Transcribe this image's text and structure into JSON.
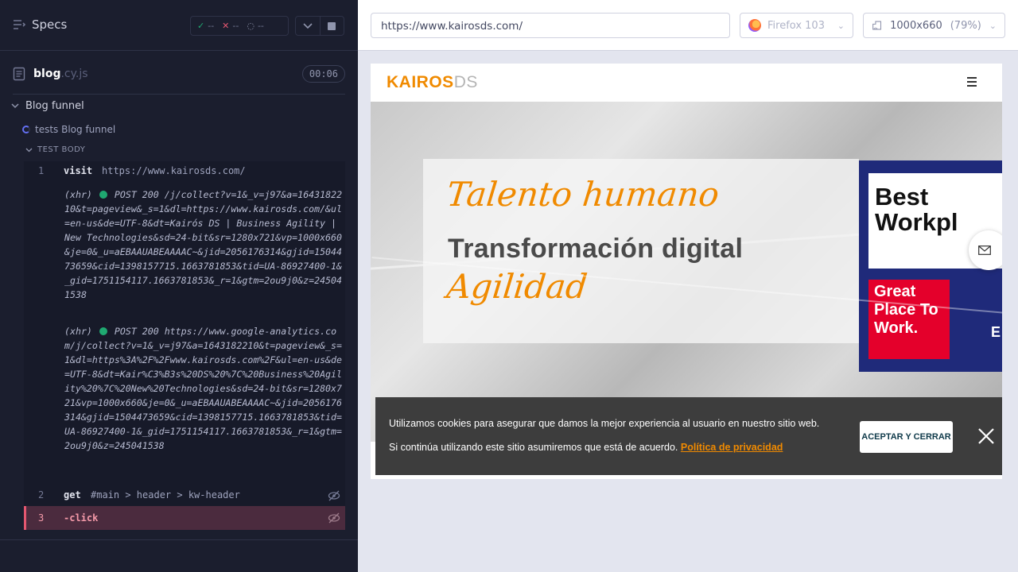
{
  "runner": {
    "specs_label": "Specs",
    "stats": {
      "passed": "--",
      "failed": "--",
      "pending": "--"
    },
    "file": {
      "name": "blog",
      "ext": ".cy.js",
      "duration": "00:06"
    },
    "suite": "Blog funnel",
    "test": "tests Blog funnel",
    "test_body": "TEST BODY",
    "commands": [
      {
        "num": "1",
        "name": "visit",
        "message": "https://www.kairosds.com/"
      },
      {
        "num": "2",
        "name": "get",
        "message": "#main > header > kw-header"
      },
      {
        "num": "3",
        "name": "-click",
        "message": ""
      }
    ],
    "xhr": [
      {
        "prefix": "(xhr)",
        "text": "POST 200 /j/collect?v=1&_v=j97&a=1643182210&t=pageview&_s=1&dl=https://www.kairosds.com/&ul=en-us&de=UTF-8&dt=Kairós DS | Business Agility | New Technologies&sd=24-bit&sr=1280x721&vp=1000x660&je=0&_u=aEBAAUABEAAAAC~&jid=2056176314&gjid=1504473659&cid=1398157715.1663781853&tid=UA-86927400-1&_gid=1751154117.1663781853&_r=1&gtm=2ou9j0&z=245041538"
      },
      {
        "prefix": "(xhr)",
        "text": "POST 200 https://www.google-analytics.com/j/collect?v=1&_v=j97&a=1643182210&t=pageview&_s=1&dl=https%3A%2F%2Fwww.kairosds.com%2F&ul=en-us&de=UTF-8&dt=Kair%C3%B3s%20DS%20%7C%20Business%20Agility%20%7C%20New%20Technologies&sd=24-bit&sr=1280x721&vp=1000x660&je=0&_u=aEBAAUABEAAAAC~&jid=2056176314&gjid=1504473659&cid=1398157715.1663781853&tid=UA-86927400-1&_gid=1751154117.1663781853&_r=1&gtm=2ou9j0&z=245041538"
      }
    ]
  },
  "aut": {
    "url": "https://www.kairosds.com/",
    "browser": "Firefox 103",
    "viewport": "1000x660",
    "zoom": "(79%)"
  },
  "site": {
    "logo_main": "KAIROS",
    "logo_ds": "DS",
    "hero_line1": "Talento humano",
    "hero_line2": "Transformación digital",
    "hero_line3": "Agilidad",
    "badge_top": "Best Workpl",
    "badge_red": "Great Place To Work.",
    "badge_e": "E",
    "cookie_line1": "Utilizamos cookies para asegurar que damos la mejor experiencia al usuario en nuestro sitio web.",
    "cookie_line2": "Si continúa utilizando este sitio asumiremos que está de acuerdo.",
    "cookie_link": "Política de privacidad",
    "cookie_accept": "ACEPTAR Y CERRAR"
  },
  "colors": {
    "brand_orange": "#f08a00",
    "cypress_dark": "#1b1e2e",
    "active_cmd": "#4b2b3e"
  }
}
